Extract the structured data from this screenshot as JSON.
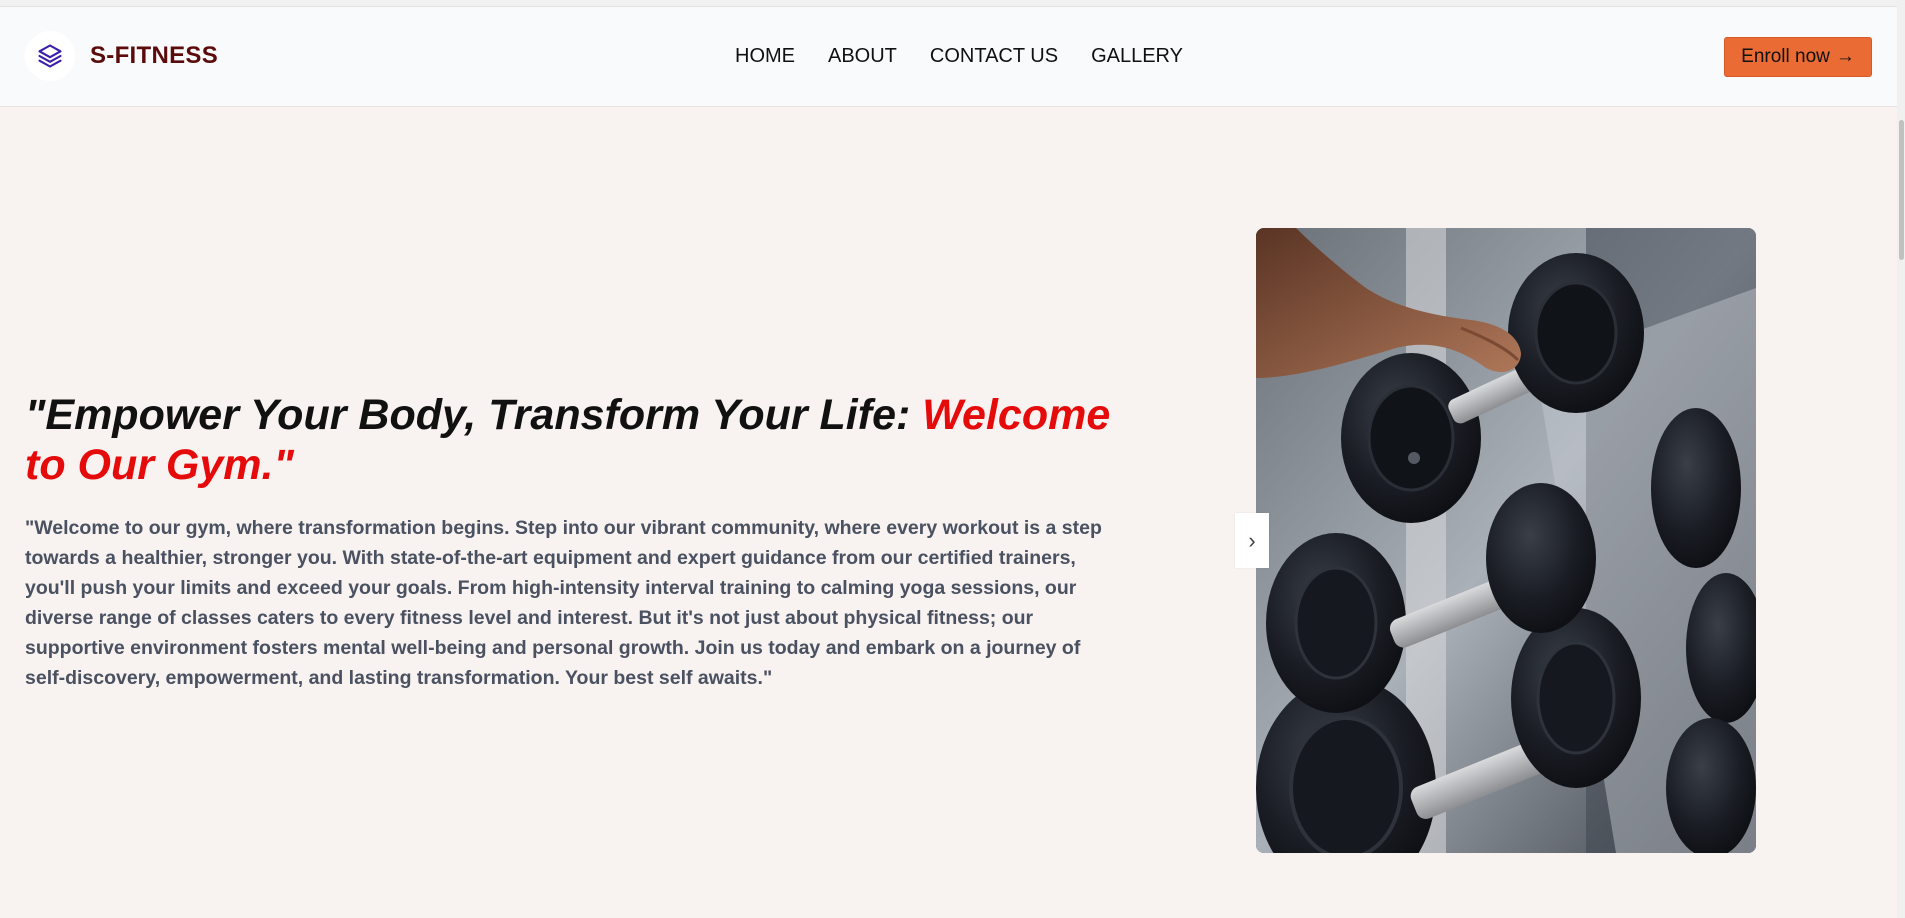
{
  "brand": {
    "name": "S-FITNESS",
    "logo_icon": "stack-layers-icon",
    "logo_color": "#3b1fa8",
    "name_color": "#5b0b0b"
  },
  "nav": {
    "items": [
      {
        "label": "HOME"
      },
      {
        "label": "ABOUT"
      },
      {
        "label": "CONTACT US"
      },
      {
        "label": "GALLERY"
      }
    ]
  },
  "cta": {
    "label": "Enroll now",
    "icon": "arrow-right-icon",
    "arrow": "→",
    "color": "#ea6b34"
  },
  "hero": {
    "headline_plain": "\"Empower Your Body, Transform Your Life: ",
    "headline_accent": "Welcome to Our Gym.\"",
    "accent_color": "#e60b0b",
    "description": "\"Welcome to our gym, where transformation begins. Step into our vibrant community, where every workout is a step towards a healthier, stronger you. With state-of-the-art equipment and expert guidance from our certified trainers, you'll push your limits and exceed your goals. From high-intensity interval training to calming yoga sessions, our diverse range of classes caters to every fitness level and interest. But it's not just about physical fitness; our supportive environment fosters mental well-being and personal growth. Join us today and embark on a journey of self-discovery, empowerment, and lasting transformation. Your best self awaits.\""
  },
  "carousel": {
    "next_glyph": "›",
    "next_icon": "chevron-right-icon",
    "image_subject": "dumbbell-rack-photo"
  }
}
